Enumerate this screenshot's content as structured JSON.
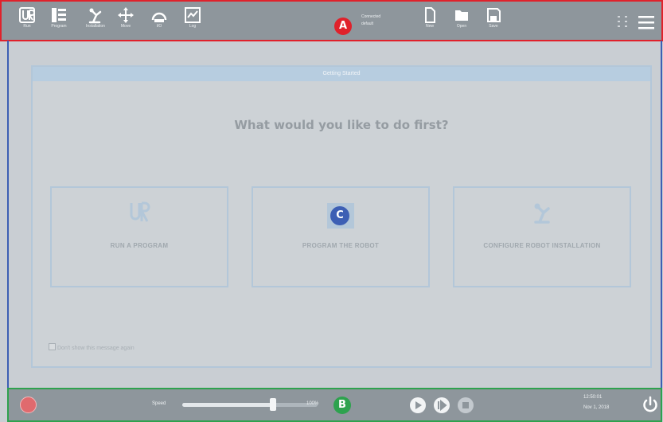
{
  "header": {
    "nav": [
      {
        "label": "Run",
        "icon": "ur-logo-icon"
      },
      {
        "label": "Program",
        "icon": "program-list-icon"
      },
      {
        "label": "Installation",
        "icon": "robot-arm-icon"
      },
      {
        "label": "Move",
        "icon": "move-arrows-icon"
      },
      {
        "label": "I/O",
        "icon": "io-icon"
      },
      {
        "label": "Log",
        "icon": "log-icon"
      }
    ],
    "status": {
      "line1": "Connected",
      "line2": "default"
    },
    "file_actions": [
      {
        "label": "New",
        "icon": "new-file-icon"
      },
      {
        "label": "Open",
        "icon": "folder-icon"
      },
      {
        "label": "Save",
        "icon": "save-icon"
      }
    ],
    "menu_icon": "hamburger-menu-icon"
  },
  "markers": {
    "a": "A",
    "b": "B",
    "c": "C"
  },
  "dialog": {
    "title": "Getting Started",
    "question": "What would you like to do first?",
    "options": [
      {
        "label": "RUN A PROGRAM",
        "icon": "ur-logo-icon"
      },
      {
        "label": "PROGRAM THE ROBOT",
        "icon": "program-icon"
      },
      {
        "label": "CONFIGURE ROBOT INSTALLATION",
        "icon": "robot-arm-icon"
      }
    ],
    "dont_show": "Don't show this message again"
  },
  "footer": {
    "speed_label": "Speed",
    "speed_percent": 0.67,
    "speed_value": "100%",
    "time": "12:50:01",
    "date": "Nov 1, 2018"
  },
  "colors": {
    "marker_a": "#e0212b",
    "marker_b": "#2ea24e",
    "marker_c": "#3d5fb4",
    "header_bg": "#8e969c",
    "dialog_border": "#b3c7d9"
  }
}
